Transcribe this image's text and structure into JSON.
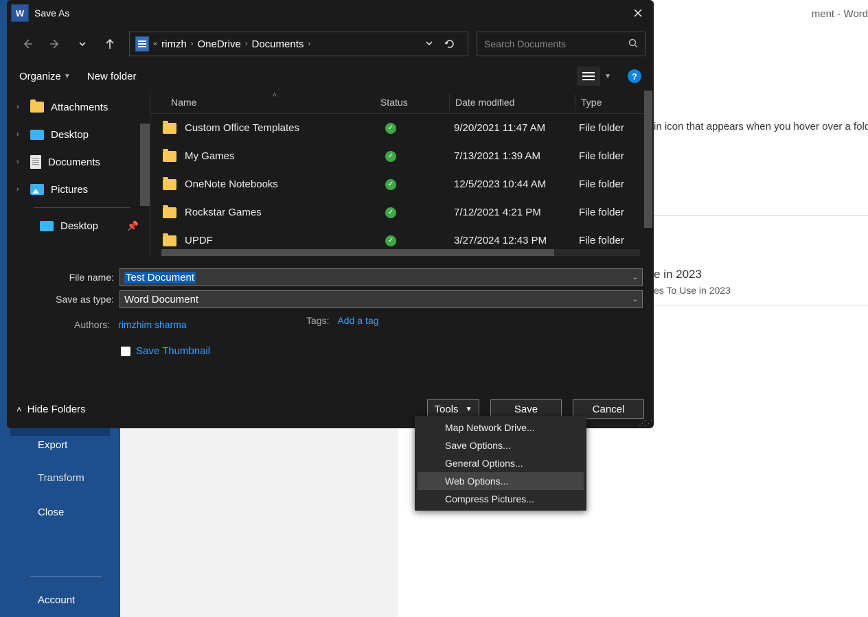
{
  "word": {
    "titlebar_suffix": "ment  -  Word",
    "bg_text": "in icon that appears when you hover over a fold",
    "heading_suffix": "e in 2023",
    "subheading_suffix": "es To Use in 2023",
    "sidebar": {
      "export": "Export",
      "transform": "Transform",
      "close": "Close",
      "account": "Account"
    }
  },
  "dialog": {
    "title": "Save As",
    "breadcrumb": {
      "p1": "rimzh",
      "p2": "OneDrive",
      "p3": "Documents"
    },
    "search_placeholder": "Search Documents",
    "toolbar": {
      "organize": "Organize",
      "new_folder": "New folder",
      "help": "?"
    },
    "tree": [
      {
        "label": "Attachments",
        "icon": "folder",
        "chev": true
      },
      {
        "label": "Desktop",
        "icon": "desktop",
        "chev": true
      },
      {
        "label": "Documents",
        "icon": "doc",
        "chev": true
      },
      {
        "label": "Pictures",
        "icon": "pic",
        "chev": true
      },
      {
        "label": "Desktop",
        "icon": "desktop",
        "pinned": true
      }
    ],
    "columns": {
      "name": "Name",
      "status": "Status",
      "date": "Date modified",
      "type": "Type"
    },
    "rows": [
      {
        "name": "Custom Office Templates",
        "date": "9/20/2021 11:47 AM",
        "type": "File folder"
      },
      {
        "name": "My Games",
        "date": "7/13/2021 1:39 AM",
        "type": "File folder"
      },
      {
        "name": "OneNote Notebooks",
        "date": "12/5/2023 10:44 AM",
        "type": "File folder"
      },
      {
        "name": "Rockstar Games",
        "date": "7/12/2021 4:21 PM",
        "type": "File folder"
      },
      {
        "name": "UPDF",
        "date": "3/27/2024 12:43 PM",
        "type": "File folder"
      }
    ],
    "file_name_label": "File name:",
    "file_name_value": "Test Document",
    "save_type_label": "Save as type:",
    "save_type_value": "Word Document",
    "authors_label": "Authors:",
    "authors_value": "rimzhim sharma",
    "tags_label": "Tags:",
    "tags_value": "Add a tag",
    "save_thumbnail": "Save Thumbnail",
    "hide_folders": "Hide Folders",
    "tools": "Tools",
    "save": "Save",
    "cancel": "Cancel"
  },
  "tools_menu": [
    "Map Network Drive...",
    "Save Options...",
    "General Options...",
    "Web Options...",
    "Compress Pictures..."
  ]
}
